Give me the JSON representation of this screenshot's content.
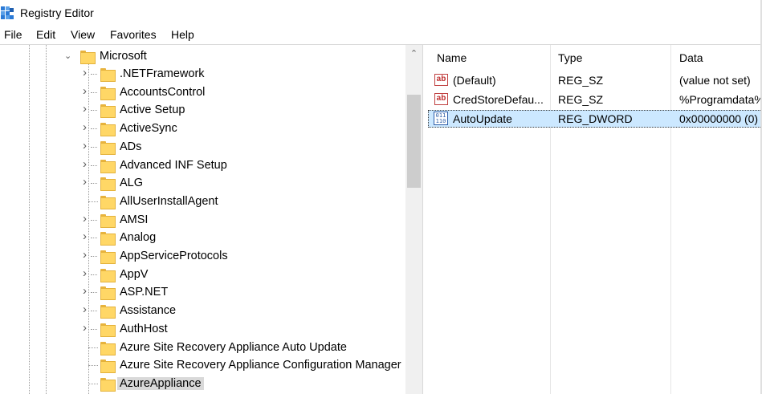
{
  "window": {
    "title": "Registry Editor",
    "icon": "registry-editor-icon"
  },
  "menu": [
    "File",
    "Edit",
    "View",
    "Favorites",
    "Help"
  ],
  "tree": {
    "parent": {
      "label": "Microsoft",
      "expanded": true
    },
    "children": [
      {
        "label": ".NETFramework",
        "expandable": true
      },
      {
        "label": "AccountsControl",
        "expandable": true
      },
      {
        "label": "Active Setup",
        "expandable": true
      },
      {
        "label": "ActiveSync",
        "expandable": true
      },
      {
        "label": "ADs",
        "expandable": true
      },
      {
        "label": "Advanced INF Setup",
        "expandable": true
      },
      {
        "label": "ALG",
        "expandable": true
      },
      {
        "label": "AllUserInstallAgent",
        "expandable": false
      },
      {
        "label": "AMSI",
        "expandable": true
      },
      {
        "label": "Analog",
        "expandable": true
      },
      {
        "label": "AppServiceProtocols",
        "expandable": true
      },
      {
        "label": "AppV",
        "expandable": true
      },
      {
        "label": "ASP.NET",
        "expandable": true
      },
      {
        "label": "Assistance",
        "expandable": true
      },
      {
        "label": "AuthHost",
        "expandable": true
      },
      {
        "label": "Azure Site Recovery Appliance Auto Update",
        "expandable": false
      },
      {
        "label": "Azure Site Recovery Appliance Configuration Manager",
        "expandable": false
      },
      {
        "label": "AzureAppliance",
        "expandable": false,
        "selected": true
      }
    ]
  },
  "list": {
    "columns": {
      "name": "Name",
      "type": "Type",
      "data": "Data"
    },
    "rows": [
      {
        "icon": "string-value-icon",
        "name": "(Default)",
        "type": "REG_SZ",
        "data": "(value not set)"
      },
      {
        "icon": "string-value-icon",
        "name": "CredStoreDefau...",
        "type": "REG_SZ",
        "data": "%Programdata%"
      },
      {
        "icon": "binary-value-icon",
        "name": "AutoUpdate",
        "type": "REG_DWORD",
        "data": "0x00000000 (0)",
        "selected": true
      }
    ]
  },
  "colors": {
    "selection": "#cce8ff",
    "tree_selection": "#d9d9d9",
    "folder": "#ffd766"
  }
}
